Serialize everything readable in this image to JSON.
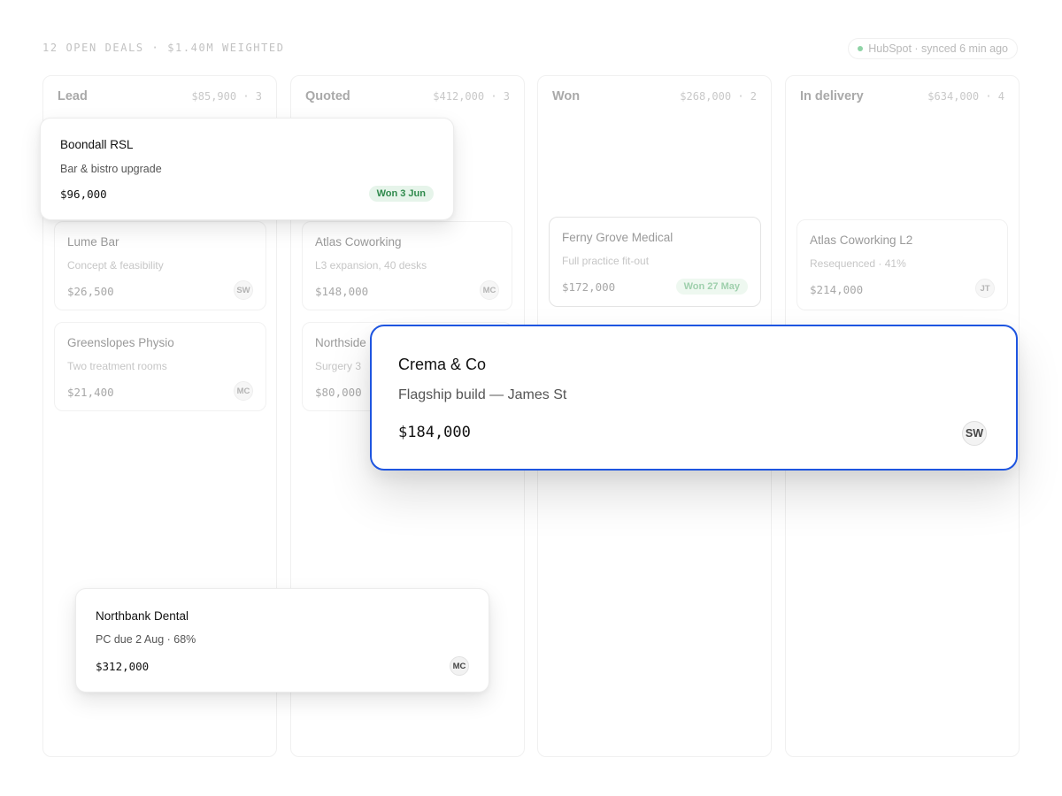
{
  "header": {
    "summary": "12 OPEN DEALS · $1.40M WEIGHTED",
    "sync_status": "HubSpot · synced 6 min ago"
  },
  "columns": [
    {
      "title": "Lead",
      "meta": "$85,900 · 3",
      "cards": [
        {
          "name": "Lume Bar",
          "sub": "Concept & feasibility",
          "amount": "$26,500",
          "owner": "SW"
        },
        {
          "name": "Greenslopes Physio",
          "sub": "Two treatment rooms",
          "amount": "$21,400",
          "owner": "MC"
        }
      ]
    },
    {
      "title": "Quoted",
      "meta": "$412,000 · 3",
      "cards": [
        {
          "name": "Atlas Coworking",
          "sub": "L3 expansion, 40 desks",
          "amount": "$148,000",
          "owner": "MC"
        },
        {
          "name": "Northside",
          "sub": "Surgery 3",
          "amount": "$80,000",
          "owner": ""
        }
      ]
    },
    {
      "title": "Won",
      "meta": "$268,000 · 2",
      "cards": [
        {
          "name": "Ferny Grove Medical",
          "sub": "Full practice fit-out",
          "amount": "$172,000",
          "badge": "Won 27 May"
        }
      ]
    },
    {
      "title": "In delivery",
      "meta": "$634,000 · 4",
      "cards": [
        {
          "name": "Atlas Coworking L2",
          "sub": "Resequenced · 41%",
          "amount": "$214,000",
          "owner": "JT"
        }
      ]
    }
  ],
  "floating_cards": [
    {
      "name": "Boondall RSL",
      "sub": "Bar & bistro upgrade",
      "amount": "$96,000",
      "badge": "Won 3 Jun"
    },
    {
      "name": "Northbank Dental",
      "sub": "PC due 2 Aug · 68%",
      "amount": "$312,000",
      "owner": "MC"
    }
  ],
  "dragged_card": {
    "name": "Crema & Co",
    "sub": "Flagship build — James St",
    "amount": "$184,000",
    "owner": "SW"
  },
  "colors": {
    "accent": "#1e55e0",
    "won_badge_bg": "#e6f4ea",
    "won_badge_text": "#2f8a4c",
    "sync_dot": "#8fd3a6"
  }
}
